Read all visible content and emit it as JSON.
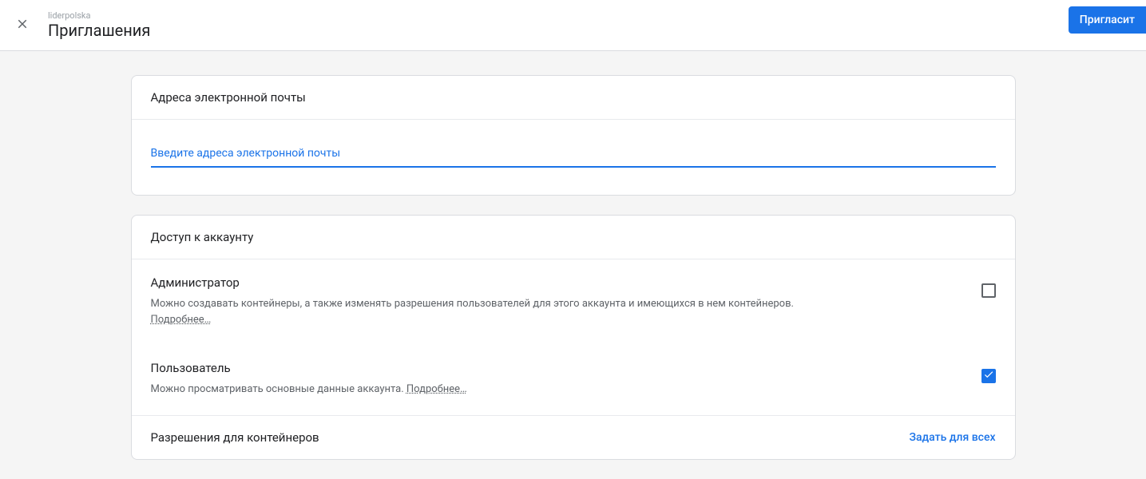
{
  "header": {
    "breadcrumb": "liderpolska",
    "title": "Приглашения",
    "inviteButton": "Пригласит"
  },
  "emailCard": {
    "title": "Адреса электронной почты",
    "placeholder": "Введите адреса электронной почты"
  },
  "accessCard": {
    "title": "Доступ к аккаунту",
    "roles": [
      {
        "title": "Администратор",
        "desc": "Можно создавать контейнеры, а также изменять разрешения пользователей для этого аккаунта и имеющихся в нем контейнеров. ",
        "learnMore": "Подробнее…",
        "checked": false
      },
      {
        "title": "Пользователь",
        "desc": "Можно просматривать основные данные аккаунта. ",
        "learnMore": "Подробнее…",
        "checked": true
      }
    ],
    "permissions": {
      "label": "Разрешения для контейнеров",
      "setAll": "Задать для всех"
    }
  }
}
